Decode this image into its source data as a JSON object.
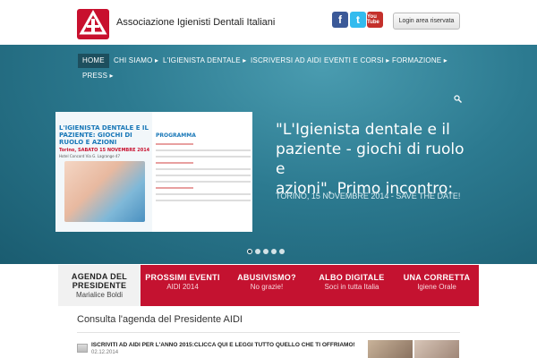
{
  "header": {
    "logo_letters": "AIDI",
    "site_title": "Associazione Igienisti Dentali Italiani",
    "social": {
      "facebook": "f",
      "twitter": "t",
      "youtube": "You Tube"
    },
    "login_label": "Login area riservata"
  },
  "nav": {
    "items": [
      {
        "label": "HOME",
        "active": true
      },
      {
        "label": "CHI SIAMO ▸"
      },
      {
        "label": "L'IGIENISTA DENTALE ▸"
      },
      {
        "label": "ISCRIVERSI AD AIDI"
      },
      {
        "label": "EVENTI E CORSI ▸"
      },
      {
        "label": "FORMAZIONE ▸"
      },
      {
        "label": "PRESS ▸"
      }
    ],
    "search_icon": "search-icon"
  },
  "slide": {
    "image_title": "L'IGIENISTA DENTALE E IL PAZIENTE: GIOCHI DI RUOLO E AZIONI",
    "image_date": "Torino, SABATO 15 NOVEMBRE 2014",
    "image_address": "Hotel Concord Via G. Lagrange 47",
    "image_program": "PROGRAMMA",
    "heading_lines": [
      "\"L'Igienista dentale e il",
      "paziente - giochi di ruolo e",
      "azioni\". Primo incontro:"
    ],
    "subtitle": "TORINO, 15 NOVEMBRE 2014 - SAVE THE DATE!",
    "slide_count": 5,
    "active_slide": 1
  },
  "tabs": [
    {
      "title": "AGENDA DEL PRESIDENTE",
      "subtitle": "Marialice Boldi",
      "active": true
    },
    {
      "title": "PROSSIMI EVENTI",
      "subtitle": "AIDI 2014"
    },
    {
      "title": "ABUSIVISMO?",
      "subtitle": "No grazie!"
    },
    {
      "title": "ALBO DIGITALE",
      "subtitle": "Soci in tutta Italia"
    },
    {
      "title": "UNA CORRETTA",
      "subtitle": "Igiene Orale"
    }
  ],
  "content": {
    "section_title": "Consulta l'agenda del Presidente AIDI",
    "post_title": "ISCRIVITI AD AIDI PER L'ANNO 2015:CLICCA QUI E LEGGI TUTTO QUELLO CHE TI OFFRIAMO!",
    "post_date": "02.12.2014"
  },
  "colors": {
    "brand_red": "#c41230",
    "hero_teal": "#2c7a90",
    "nav_active": "#1d4f5e"
  }
}
